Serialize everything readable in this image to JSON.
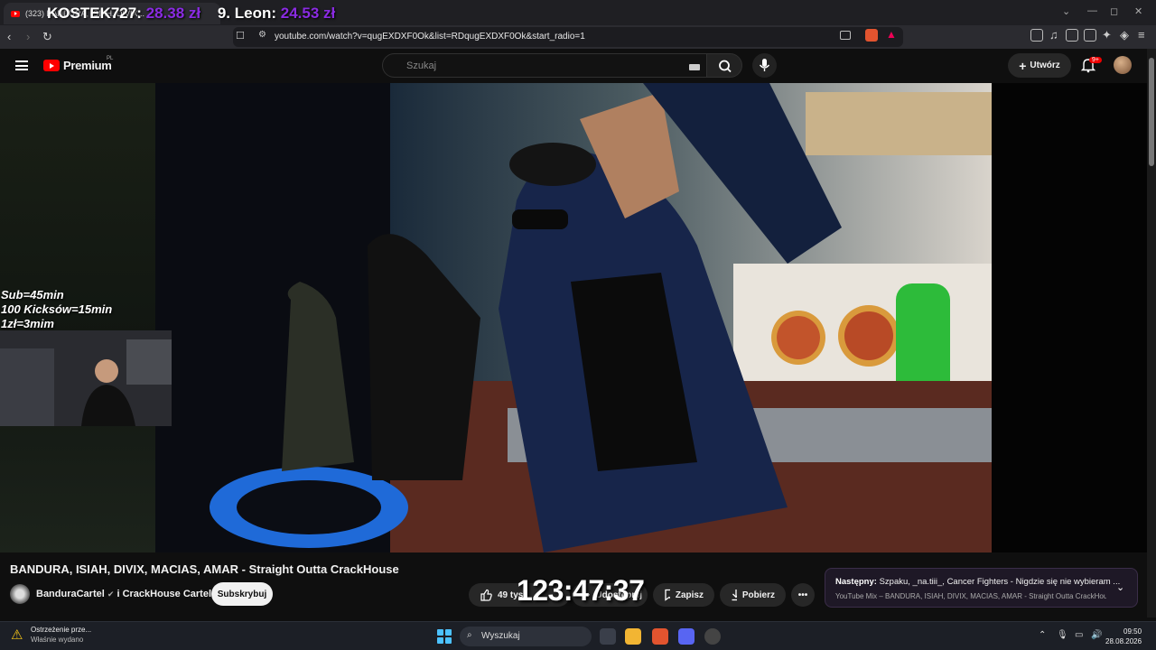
{
  "browser": {
    "tab_title": "(323) BANDURA, ISIAH, DIVIX...",
    "url": "youtube.com/watch?v=qugEXDXF0Ok&list=RDqugEXDXF0Ok&start_radio=1"
  },
  "stream_overlay": {
    "leaderboard_1_name": "KOSTEK727:",
    "leaderboard_1_amount": "28.38 zł",
    "leaderboard_2_name": "9. Leon:",
    "leaderboard_2_amount": "24.53 zł",
    "sub_rules": [
      "Sub=45min",
      "100 Kicksów=15min",
      "1zł=3mim"
    ],
    "timer": "123:47:37"
  },
  "youtube": {
    "logo_text": "Premium",
    "logo_country": "PL",
    "search_placeholder": "Szukaj",
    "create_label": "Utwórz",
    "notifications_badge": "9+"
  },
  "video": {
    "title": "BANDURA, ISIAH, DIVIX, MACIAS, AMAR - Straight Outta CrackHouse",
    "channel": "BanduraCartel",
    "channel_suffix": "i CrackHouse Cartel",
    "subscribe_label": "Subskrybuj",
    "likes": "49 tys.",
    "share_label": "Udostępnij",
    "save_label": "Zapisz",
    "download_label": "Pobierz"
  },
  "up_next": {
    "prefix": "Następny:",
    "title": "Szpaku, _na.tiii_, Cancer Fighters - Nigdzie się nie wybieram ...",
    "subtitle": "YouTube Mix – BANDURA, ISIAH, DIVIX, MACIAS, AMAR - Straight Outta CrackHouse..."
  },
  "taskbar": {
    "notification_title": "Ostrzeżenie prze...",
    "notification_sub": "Właśnie wydano",
    "search_label": "Wyszukaj",
    "time": "09:50",
    "date": "28.08.2026"
  },
  "colors": {
    "overlay_amount": "#8a2be2",
    "youtube_red": "#ff0000",
    "up_next_bg": "#1e1826"
  }
}
